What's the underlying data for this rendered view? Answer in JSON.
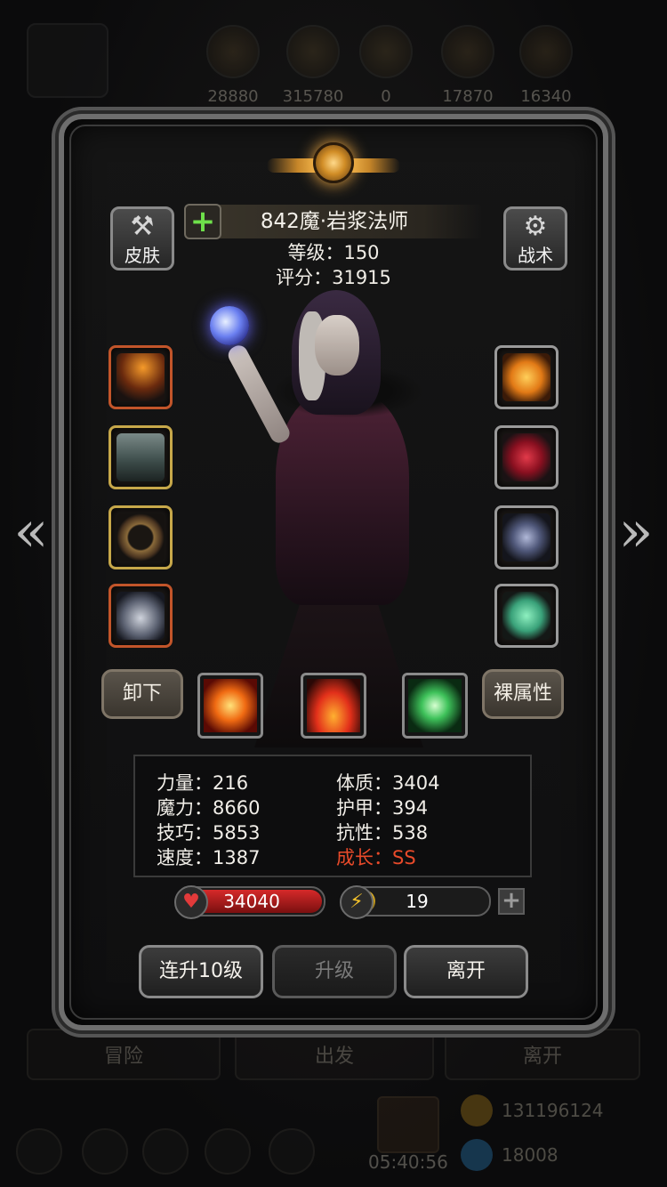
{
  "hud": {
    "resources": [
      "28880",
      "315780",
      "0",
      "17870",
      "16340"
    ],
    "bottom_tabs": [
      "冒险",
      "出发",
      "离开"
    ],
    "gold": "131196124",
    "gems": "18008",
    "timer": "05:40:56"
  },
  "hero": {
    "name": "842魔·岩浆法师",
    "level": "等级：150",
    "score": "评分：31915",
    "skin_label": "皮肤",
    "tactics_label": "战术",
    "skin_icon": "shirt-icon",
    "tactics_icon": "gear-icon"
  },
  "equipment": {
    "left": [
      {
        "name": "staff",
        "rarity": "red"
      },
      {
        "name": "robe",
        "rarity": "gold"
      },
      {
        "name": "ring",
        "rarity": "gold"
      },
      {
        "name": "dragon-helm",
        "rarity": "red"
      }
    ],
    "right": [
      {
        "name": "flame-amulet",
        "rarity": "grey"
      },
      {
        "name": "red-orb",
        "rarity": "grey"
      },
      {
        "name": "crest",
        "rarity": "grey"
      },
      {
        "name": "green-gem",
        "rarity": "grey"
      }
    ]
  },
  "skills": {
    "unequip_label": "卸下",
    "base_stats_label": "裸属性",
    "items": [
      "fire-burst",
      "flame-wall",
      "green-light"
    ]
  },
  "stats": {
    "strength": "力量：216",
    "magic": "魔力：8660",
    "skill": "技巧：5853",
    "speed": "速度：1387",
    "constitution": "体质：3404",
    "armor": "护甲：394",
    "resistance": "抗性：538",
    "growth": "成长：SS"
  },
  "bars": {
    "hp": "34040",
    "energy": "19",
    "energy_fill": 0.22,
    "hp_fill": 1.0
  },
  "actions": {
    "level_up_10": "连升10级",
    "level_up": "升级",
    "leave": "离开"
  },
  "colors": {
    "hp": "#d62a2a",
    "energy": "#f3c12b",
    "growth": "#e84a2a"
  }
}
